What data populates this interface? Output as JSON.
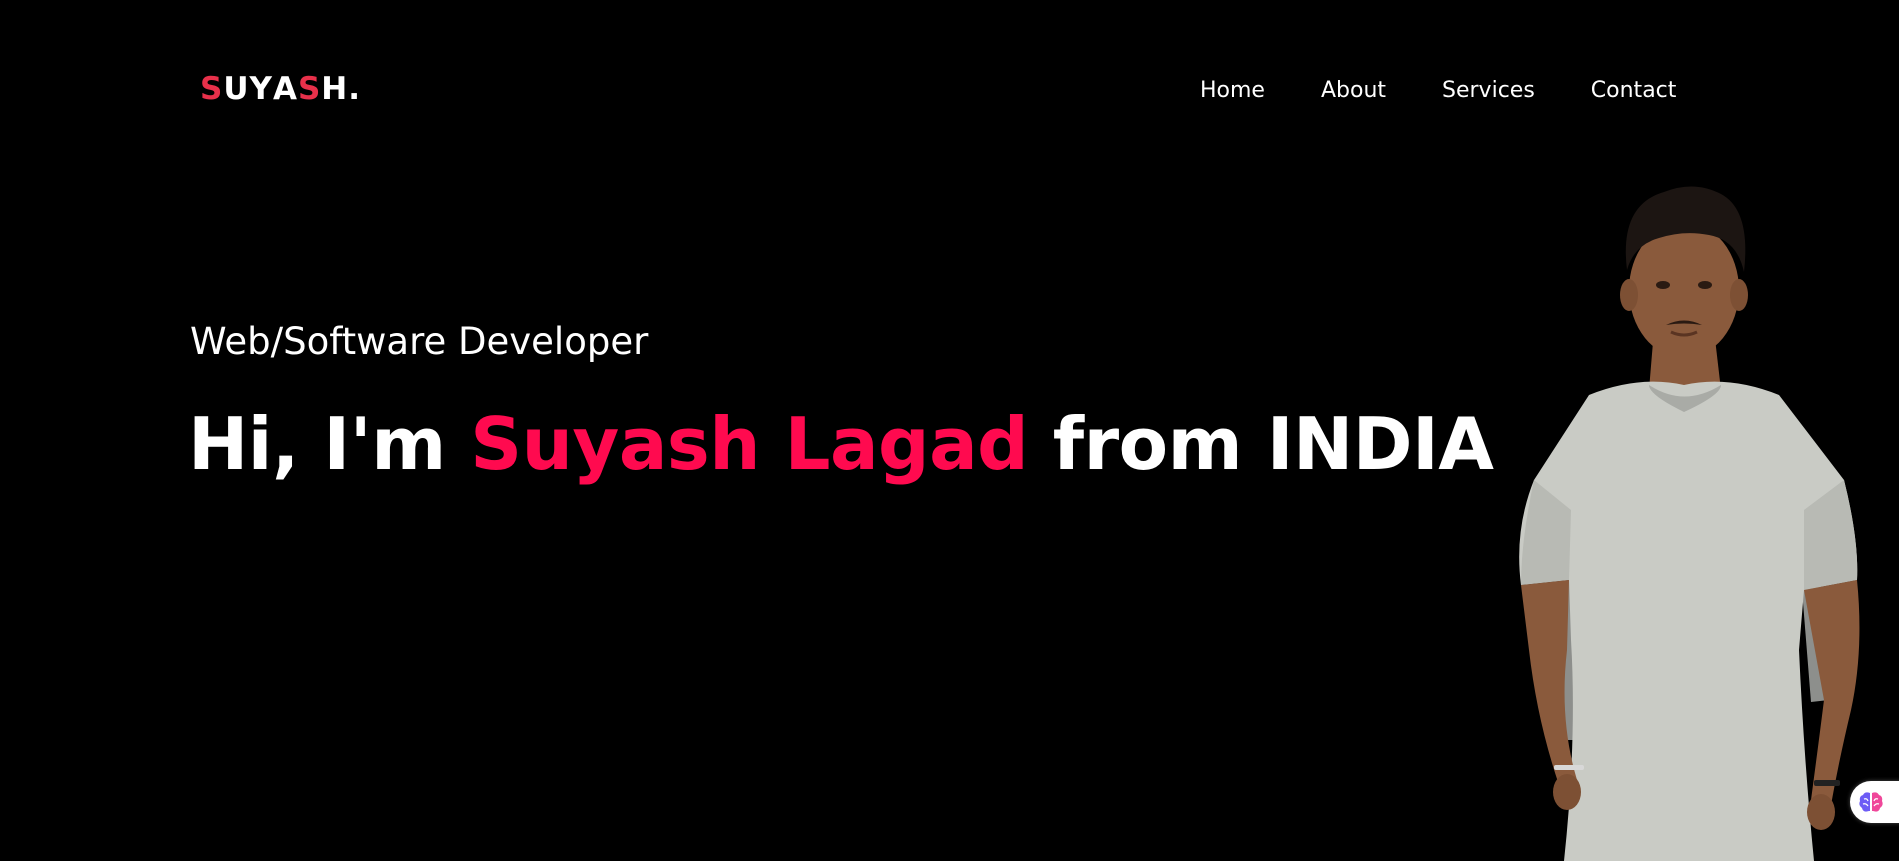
{
  "logo": {
    "letters": [
      {
        "char": "S",
        "accent": true
      },
      {
        "char": "U",
        "accent": false
      },
      {
        "char": "Y",
        "accent": false
      },
      {
        "char": "A",
        "accent": false
      },
      {
        "char": "S",
        "accent": true
      },
      {
        "char": "H",
        "accent": false
      },
      {
        "char": ".",
        "accent": false
      }
    ],
    "accent_color": "#e8304a"
  },
  "nav": {
    "items": [
      {
        "label": "Home"
      },
      {
        "label": "About"
      },
      {
        "label": "Services"
      },
      {
        "label": "Contact"
      }
    ]
  },
  "hero": {
    "subtitle": "Web/Software Developer",
    "headline_prefix": "Hi, I'm ",
    "headline_name": "Suyash Lagad",
    "headline_suffix": " from INDIA",
    "name_color": "#ff0a4f"
  },
  "portrait": {
    "description_icon": "person-photo"
  },
  "widget": {
    "icon": "brain-icon"
  }
}
